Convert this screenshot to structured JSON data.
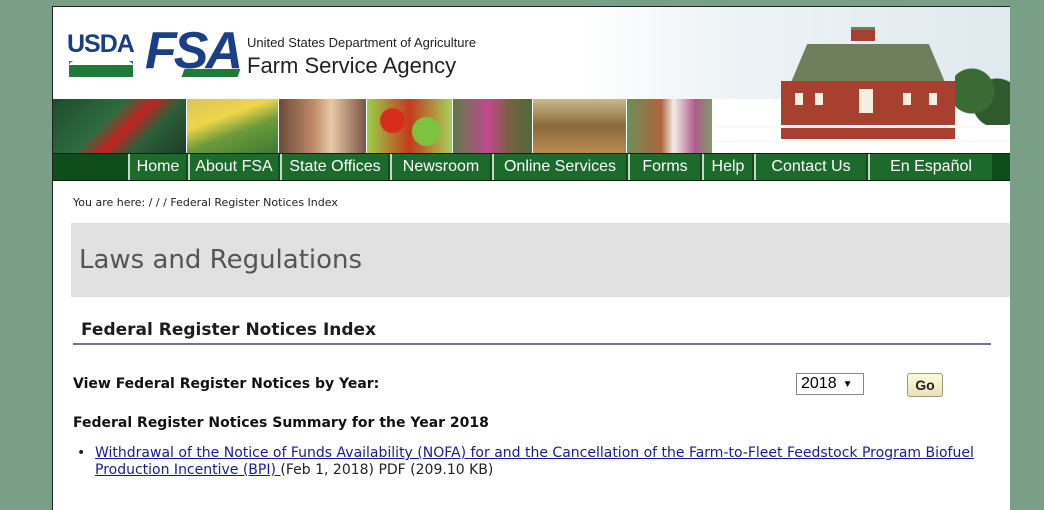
{
  "header": {
    "usda_logo": "USDA",
    "fsa_logo": "FSA",
    "department": "United States Department of Agriculture",
    "agency": "Farm Service Agency",
    "colors": {
      "brand_blue": "#1b3f86",
      "brand_green": "#1f7a3a",
      "nav_green": "#1c6a2c"
    }
  },
  "photo_strip": {
    "photos": [
      "cardinal-bird",
      "corn",
      "children-eating",
      "vegetables",
      "farmer",
      "harvester",
      "cows-child"
    ]
  },
  "nav": {
    "items": [
      {
        "label": "Home"
      },
      {
        "label": "About FSA"
      },
      {
        "label": "State Offices"
      },
      {
        "label": "Newsroom"
      },
      {
        "label": "Online Services"
      },
      {
        "label": "Forms"
      },
      {
        "label": "Help"
      },
      {
        "label": "Contact Us"
      },
      {
        "label": "En Español"
      }
    ]
  },
  "breadcrumb": {
    "text": "You are here:  / / / Federal Register Notices Index"
  },
  "main": {
    "title": "Laws and Regulations",
    "section_heading": "Federal Register Notices Index",
    "year_label": "View Federal Register Notices by Year:",
    "year_select": {
      "selected": "2018",
      "icon": "chevron-down-icon"
    },
    "go_label": "Go",
    "summary_heading": "Federal Register Notices Summary for the Year 2018",
    "notices": [
      {
        "link_text": "Withdrawal of the Notice of Funds Availability (NOFA) for and the Cancellation of the Farm-to-Fleet Feedstock Program Biofuel Production Incentive (BPI) ",
        "meta": "(Feb 1, 2018) PDF (209.10 KB)"
      }
    ]
  }
}
